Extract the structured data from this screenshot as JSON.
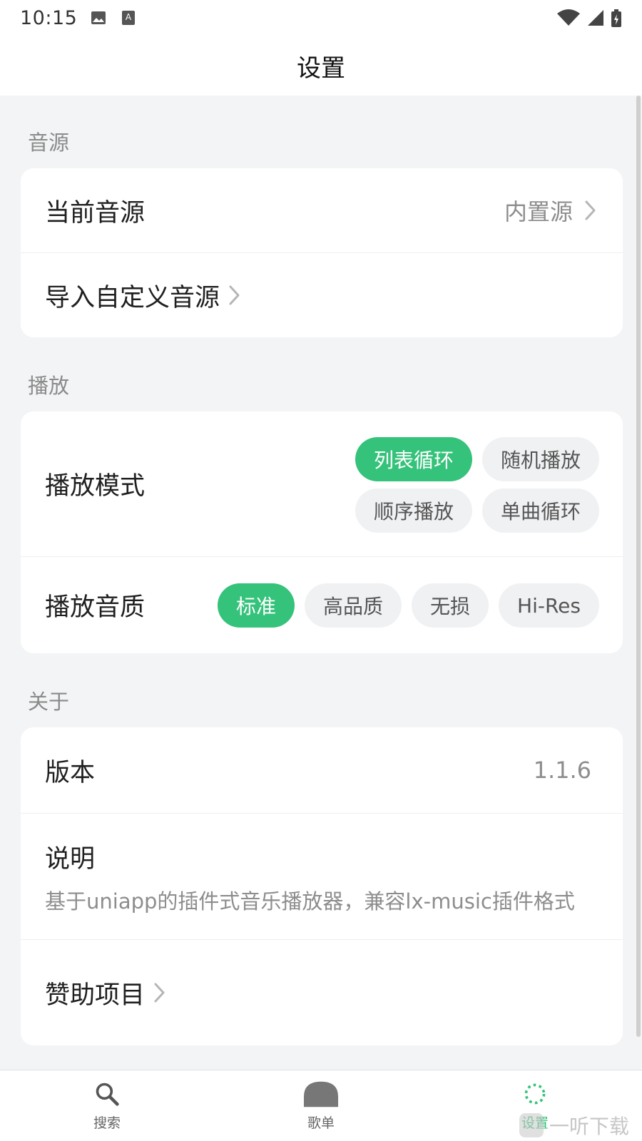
{
  "status_bar": {
    "time": "10:15",
    "icons_left": [
      "image-icon",
      "keyboard-a-icon"
    ],
    "icons_right": [
      "wifi-icon",
      "cell-signal-icon",
      "battery-charging-icon"
    ]
  },
  "header": {
    "title": "设置"
  },
  "sections": {
    "source": {
      "title": "音源",
      "current_source_label": "当前音源",
      "current_source_value": "内置源",
      "import_label": "导入自定义音源"
    },
    "playback": {
      "title": "播放",
      "mode_label": "播放模式",
      "modes": [
        "列表循环",
        "随机播放",
        "顺序播放",
        "单曲循环"
      ],
      "active_mode": "列表循环",
      "quality_label": "播放音质",
      "qualities": [
        "标准",
        "高品质",
        "无损",
        "Hi-Res"
      ],
      "active_quality": "标准"
    },
    "about": {
      "title": "关于",
      "version_label": "版本",
      "version_value": "1.1.6",
      "desc_label": "说明",
      "desc_text": "基于uniapp的插件式音乐播放器，兼容lx-music插件格式",
      "sponsor_label": "赞助项目"
    }
  },
  "tabbar": {
    "tabs": [
      {
        "label": "搜索",
        "icon": "search-icon"
      },
      {
        "label": "歌单",
        "icon": "home-icon"
      },
      {
        "label": "设置",
        "icon": "settings-dotted-icon"
      }
    ],
    "active": "设置"
  },
  "watermark": {
    "text": "一听下载"
  },
  "colors": {
    "accent": "#35c27a",
    "background": "#f3f4f6",
    "card": "#ffffff",
    "muted_text": "#8d8d8d"
  }
}
